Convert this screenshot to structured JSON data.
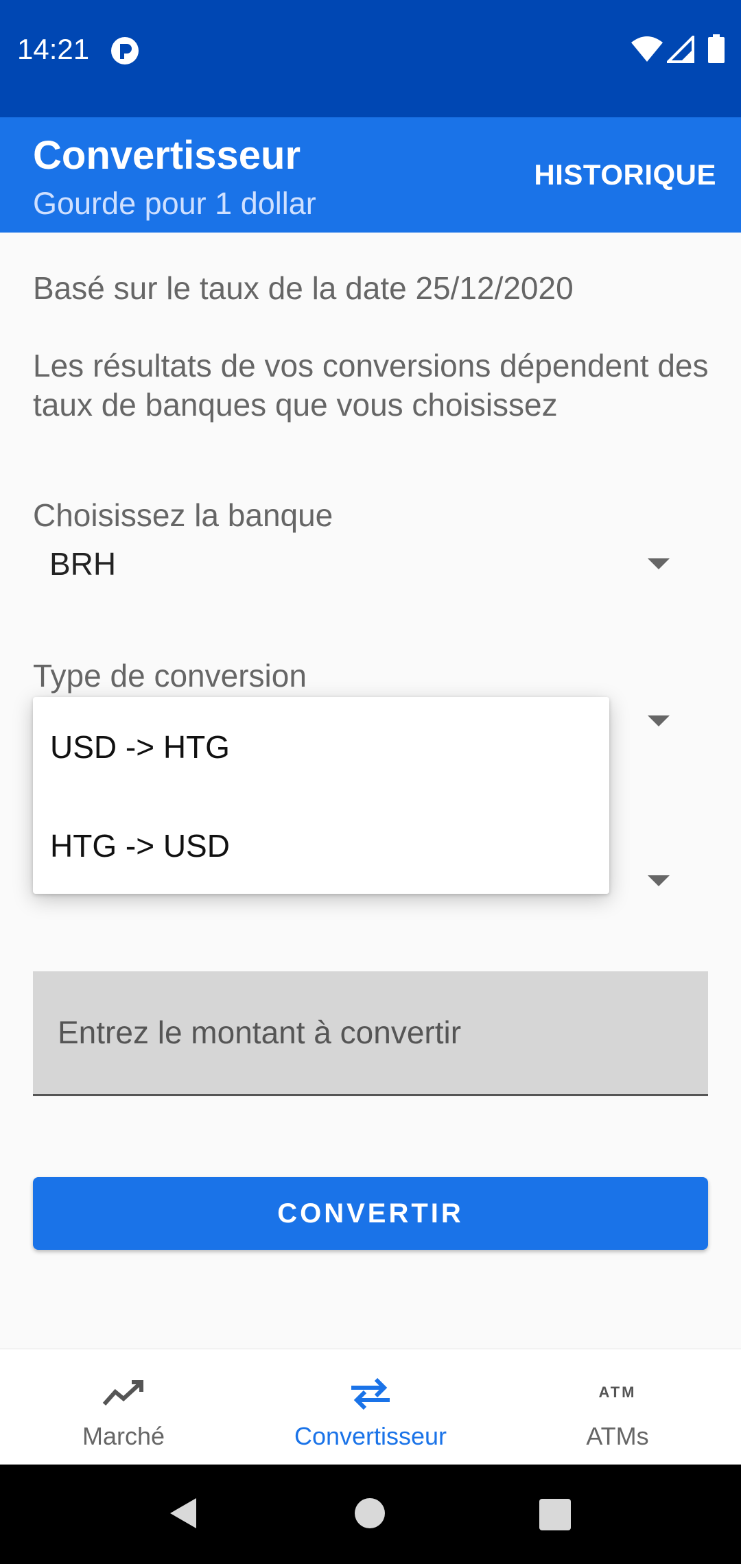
{
  "status_bar": {
    "time": "14:21",
    "icons": [
      "app-notification-icon",
      "wifi-icon",
      "cell-signal-icon",
      "battery-icon"
    ]
  },
  "app_bar": {
    "title": "Convertisseur",
    "subtitle": "Gourde pour 1 dollar",
    "action": "HISTORIQUE"
  },
  "content": {
    "rate_date": "Basé sur le taux de la date 25/12/2020",
    "disclaimer": "Les résultats de vos conversions dépendent des taux de banques que vous choisissez",
    "bank_label": "Choisissez la banque",
    "bank_value": "BRH",
    "type_label": "Type de conversion",
    "type_options": [
      "USD -> HTG",
      "HTG -> USD"
    ],
    "amount_placeholder": "Entrez le montant à convertir",
    "convert_button": "CONVERTIR"
  },
  "bottom_nav": {
    "items": [
      {
        "label": "Marché",
        "icon": "trending-up-icon",
        "active": false
      },
      {
        "label": "Convertisseur",
        "icon": "swap-arrows-icon",
        "active": true
      },
      {
        "label": "ATMs",
        "icon": "atm-icon",
        "active": false
      }
    ]
  },
  "colors": {
    "status_bar": "#0047b3",
    "primary": "#1a73e8",
    "background": "#fafafa"
  }
}
